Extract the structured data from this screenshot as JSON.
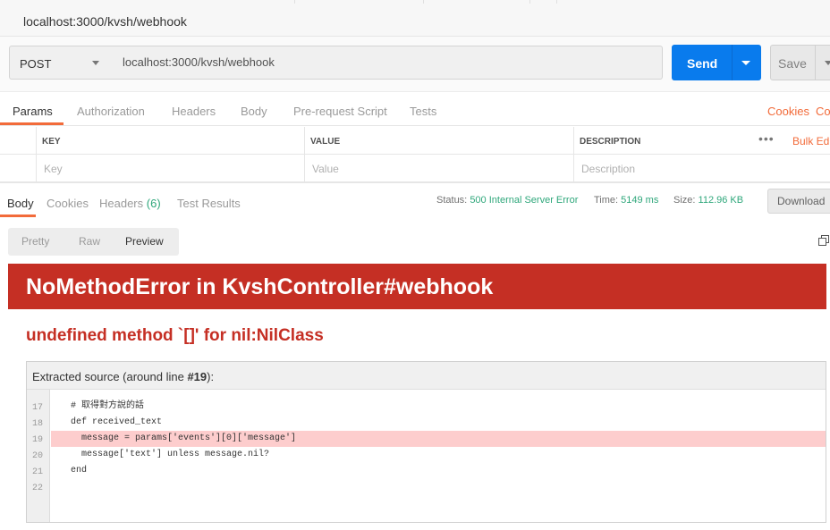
{
  "window": {
    "url_title": "localhost:3000/kvsh/webhook"
  },
  "request": {
    "method": "POST",
    "url": "localhost:3000/kvsh/webhook",
    "send_label": "Send",
    "save_label": "Save"
  },
  "request_tabs": [
    "Params",
    "Authorization",
    "Headers",
    "Body",
    "Pre-request Script",
    "Tests"
  ],
  "request_links": [
    "Cookies",
    "Co"
  ],
  "params": {
    "headers": [
      "KEY",
      "VALUE",
      "DESCRIPTION"
    ],
    "placeholders": [
      "Key",
      "Value",
      "Description"
    ],
    "more": "•••",
    "bulk_edit": "Bulk Ed"
  },
  "response": {
    "tabs": {
      "body": "Body",
      "cookies": "Cookies",
      "headers": "Headers",
      "headers_count": "(6)",
      "tests": "Test Results"
    },
    "status_label": "Status:",
    "status_value": "500 Internal Server Error",
    "time_label": "Time:",
    "time_value": "5149 ms",
    "size_label": "Size:",
    "size_value": "112.96 KB",
    "download_label": "Download",
    "view_tabs": [
      "Pretty",
      "Raw",
      "Preview"
    ]
  },
  "error_page": {
    "title": "NoMethodError in KvshController#webhook",
    "message": "undefined method `[]' for nil:NilClass",
    "source_title_prefix": "Extracted source (around line ",
    "source_title_line": "#19",
    "source_title_suffix": "):",
    "lines": [
      {
        "no": "17",
        "code": "# 取得對方說的話",
        "highlight": false
      },
      {
        "no": "18",
        "code": "def received_text",
        "highlight": false
      },
      {
        "no": "19",
        "code": "  message = params['events'][0]['message']",
        "highlight": true
      },
      {
        "no": "20",
        "code": "  message['text'] unless message.nil?",
        "highlight": false
      },
      {
        "no": "21",
        "code": "end",
        "highlight": false
      },
      {
        "no": "22",
        "code": "",
        "highlight": false
      }
    ]
  },
  "colors": {
    "accent": "#f26b3a",
    "send": "#097bed",
    "error_red": "#c52f24",
    "status_green": "#2fa77b",
    "highlight_row": "#fdcdcd"
  }
}
